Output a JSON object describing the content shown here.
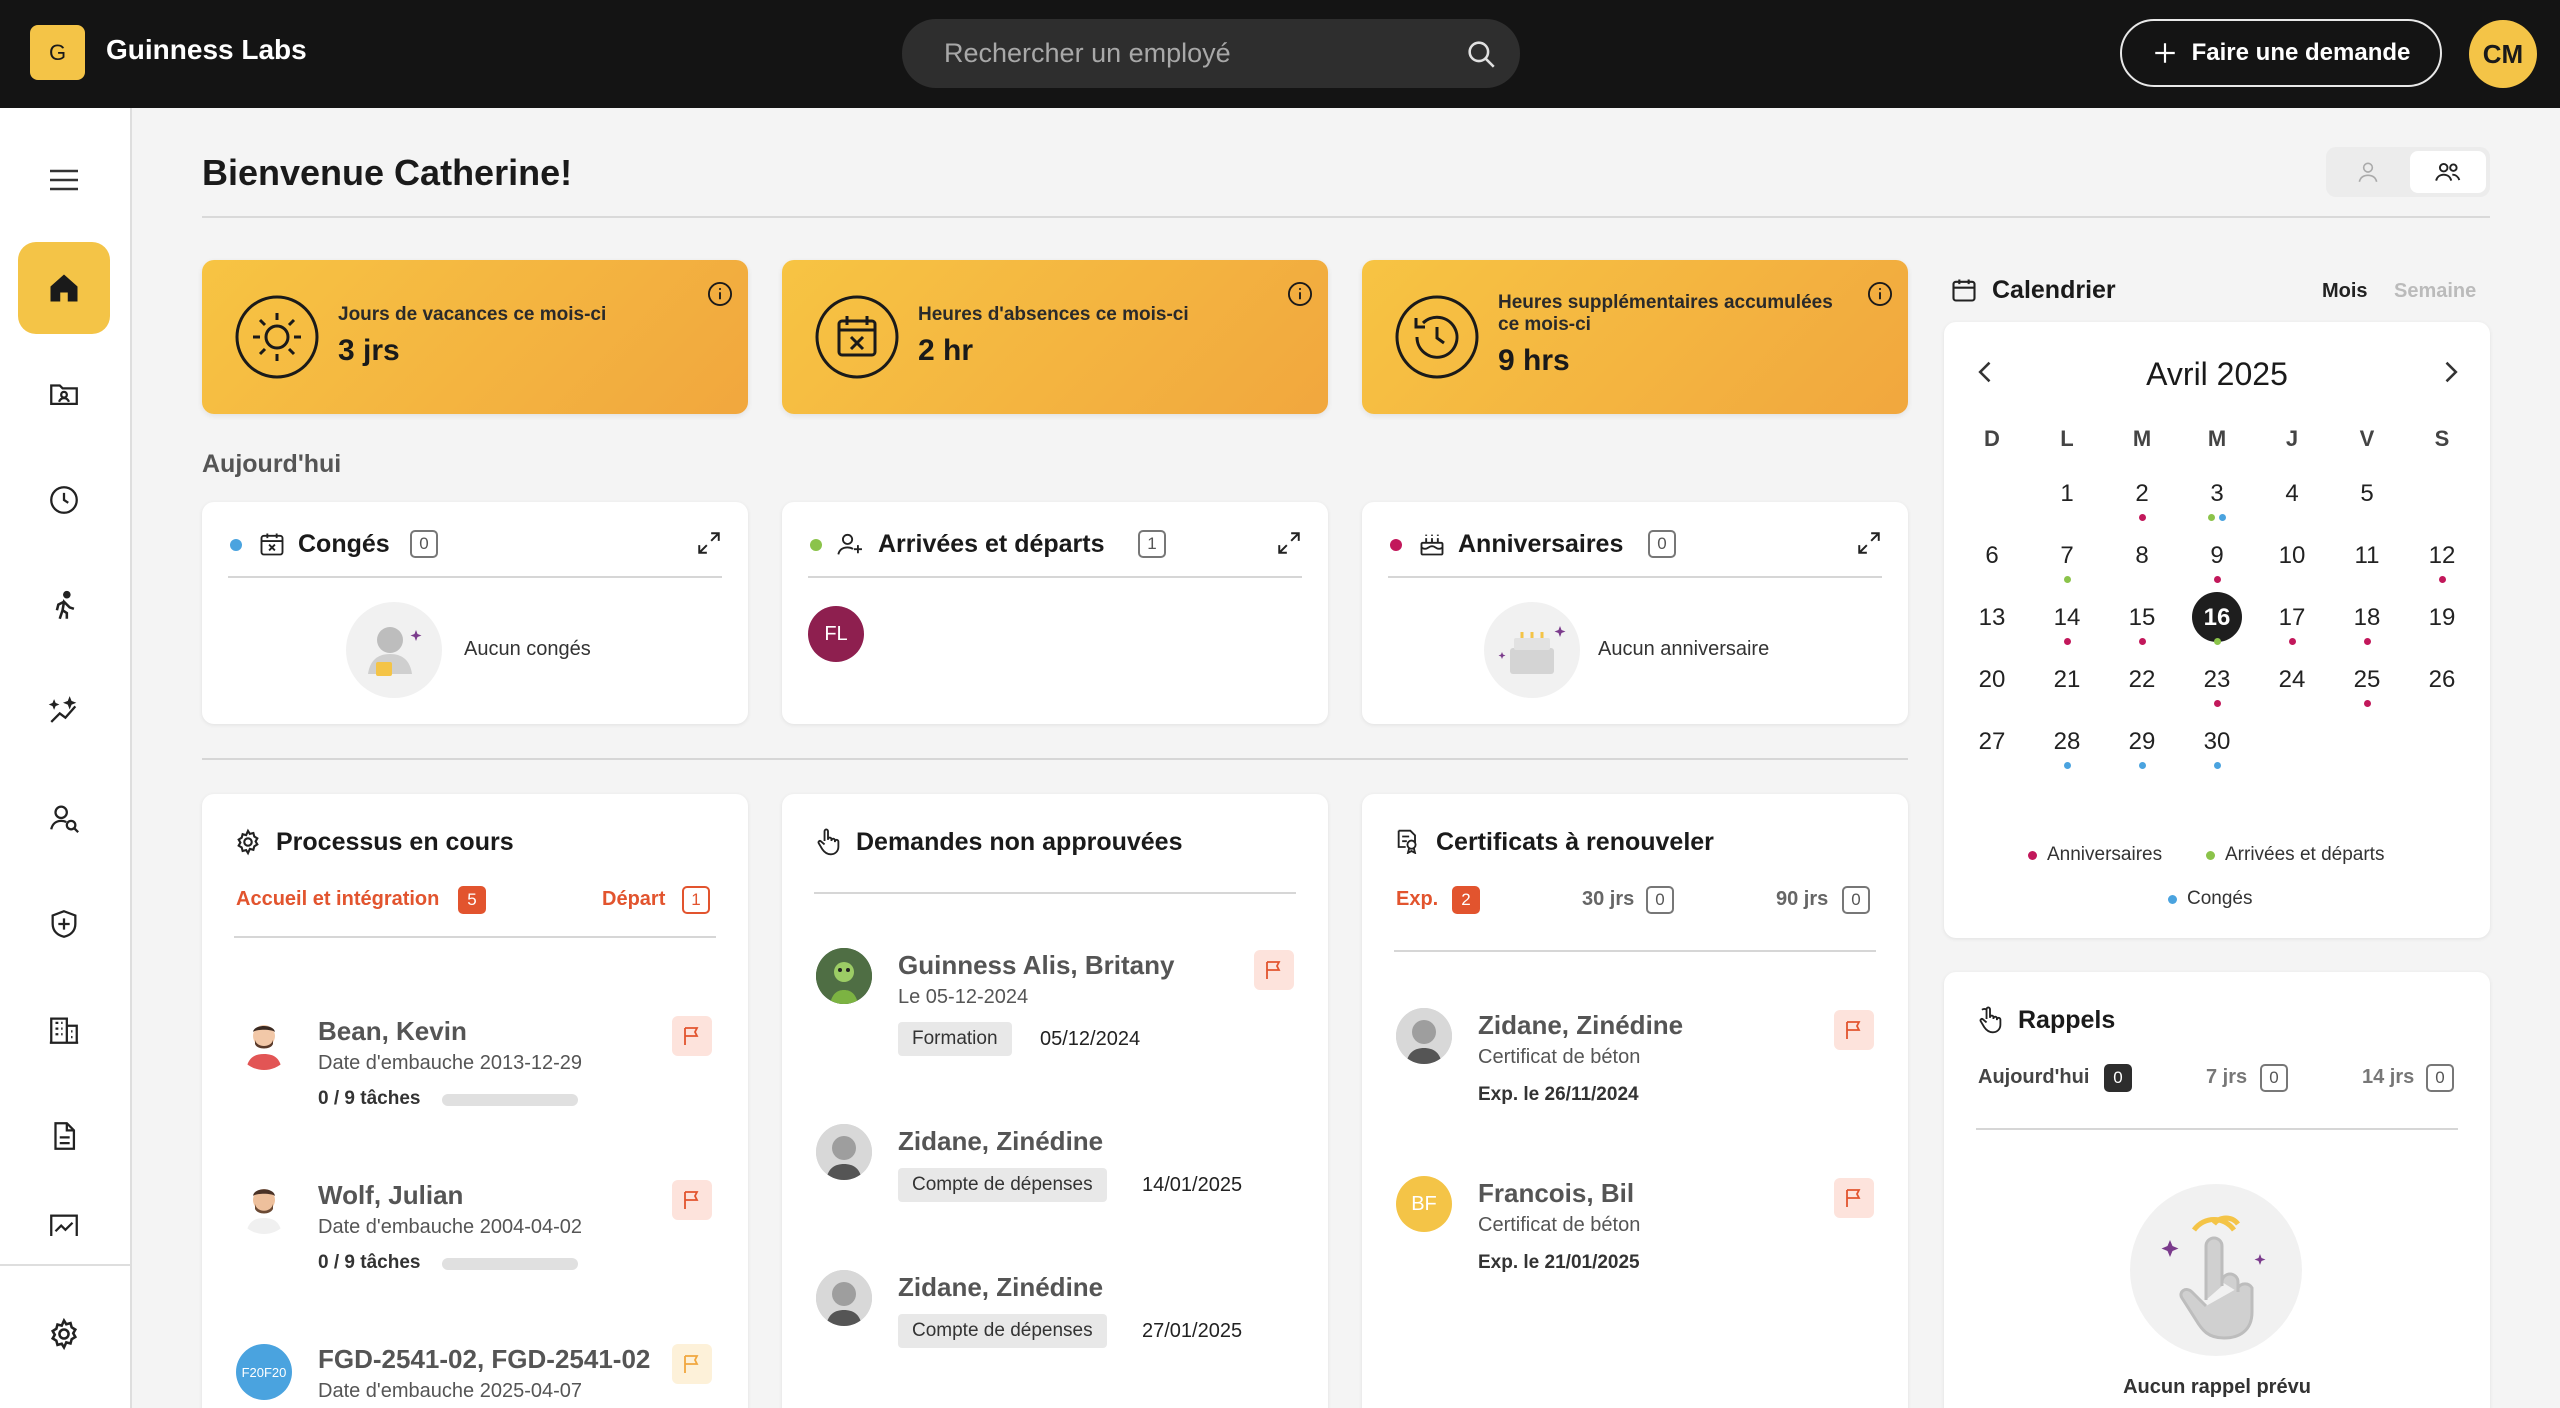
{
  "topbar": {
    "logo_letter": "G",
    "app_name": "Guinness Labs",
    "search_placeholder": "Rechercher un employé",
    "request_button": "Faire une demande",
    "user_initials": "CM"
  },
  "header": {
    "title": "Bienvenue Catherine!"
  },
  "kpis": [
    {
      "label": "Jours de vacances ce mois-ci",
      "value": "3 jrs"
    },
    {
      "label": "Heures d'absences ce mois-ci",
      "value": "2 hr"
    },
    {
      "label": "Heures supplémentaires accumulées ce mois-ci",
      "value": "9 hrs"
    }
  ],
  "today": {
    "label": "Aujourd'hui",
    "conges": {
      "title": "Congés",
      "count": "0",
      "empty": "Aucun congés"
    },
    "arrivees": {
      "title": "Arrivées et départs",
      "count": "1",
      "avatar_initials": "FL"
    },
    "anniversaires": {
      "title": "Anniversaires",
      "count": "0",
      "empty": "Aucun anniversaire"
    }
  },
  "processus": {
    "title": "Processus en cours",
    "tab_accueil": "Accueil et intégration",
    "tab_accueil_count": "5",
    "tab_depart": "Départ",
    "tab_depart_count": "1",
    "items": [
      {
        "name": "Bean, Kevin",
        "date": "Date d'embauche 2013-12-29",
        "tasks": "0 / 9 tâches"
      },
      {
        "name": "Wolf, Julian",
        "date": "Date d'embauche 2004-04-02",
        "tasks": "0 / 9 tâches"
      },
      {
        "name": "FGD-2541-02, FGD-2541-02",
        "date": "Date d'embauche 2025-04-07",
        "avatar_text": "F20F20"
      }
    ]
  },
  "demandes": {
    "title": "Demandes non approuvées",
    "items": [
      {
        "name": "Guinness Alis, Britany",
        "sub": "Le 05-12-2024",
        "tag": "Formation",
        "date": "05/12/2024"
      },
      {
        "name": "Zidane, Zinédine",
        "tag": "Compte de dépenses",
        "date": "14/01/2025"
      },
      {
        "name": "Zidane, Zinédine",
        "tag": "Compte de dépenses",
        "date": "27/01/2025"
      }
    ]
  },
  "certificats": {
    "title": "Certificats à renouveler",
    "tab_exp": "Exp.",
    "tab_exp_count": "2",
    "tab_30": "30 jrs",
    "tab_30_count": "0",
    "tab_90": "90 jrs",
    "tab_90_count": "0",
    "items": [
      {
        "name": "Zidane, Zinédine",
        "sub": "Certificat de béton",
        "exp": "Exp. le 26/11/2024"
      },
      {
        "name": "Francois, Bil",
        "sub": "Certificat de béton",
        "exp": "Exp. le 21/01/2025",
        "initials": "BF"
      }
    ]
  },
  "calendar": {
    "title": "Calendrier",
    "view_month": "Mois",
    "view_week": "Semaine",
    "month_label": "Avril 2025",
    "weekdays": [
      "D",
      "L",
      "M",
      "M",
      "J",
      "V",
      "S"
    ],
    "today": "16",
    "legend_anniv": "Anniversaires",
    "legend_arrivees": "Arrivées et départs",
    "legend_conges": "Congés",
    "colors": {
      "anniv": "#c2185b",
      "arrivees": "#8bc34a",
      "conges": "#4aa3df"
    },
    "days": [
      {
        "d": "1",
        "col": 1,
        "row": 0,
        "dots": []
      },
      {
        "d": "2",
        "col": 2,
        "row": 0,
        "dots": [
          "anniv"
        ]
      },
      {
        "d": "3",
        "col": 3,
        "row": 0,
        "dots": [
          "arrivees",
          "conges"
        ]
      },
      {
        "d": "4",
        "col": 4,
        "row": 0,
        "dots": []
      },
      {
        "d": "5",
        "col": 5,
        "row": 0,
        "dots": []
      },
      {
        "d": "6",
        "col": 0,
        "row": 1,
        "dots": []
      },
      {
        "d": "7",
        "col": 1,
        "row": 1,
        "dots": [
          "arrivees"
        ]
      },
      {
        "d": "8",
        "col": 2,
        "row": 1,
        "dots": []
      },
      {
        "d": "9",
        "col": 3,
        "row": 1,
        "dots": [
          "anniv"
        ]
      },
      {
        "d": "10",
        "col": 4,
        "row": 1,
        "dots": []
      },
      {
        "d": "11",
        "col": 5,
        "row": 1,
        "dots": []
      },
      {
        "d": "12",
        "col": 6,
        "row": 1,
        "dots": [
          "anniv"
        ]
      },
      {
        "d": "13",
        "col": 0,
        "row": 2,
        "dots": []
      },
      {
        "d": "14",
        "col": 1,
        "row": 2,
        "dots": [
          "anniv"
        ]
      },
      {
        "d": "15",
        "col": 2,
        "row": 2,
        "dots": [
          "anniv"
        ]
      },
      {
        "d": "16",
        "col": 3,
        "row": 2,
        "dots": [
          "arrivees"
        ]
      },
      {
        "d": "17",
        "col": 4,
        "row": 2,
        "dots": [
          "anniv"
        ]
      },
      {
        "d": "18",
        "col": 5,
        "row": 2,
        "dots": [
          "anniv"
        ]
      },
      {
        "d": "19",
        "col": 6,
        "row": 2,
        "dots": []
      },
      {
        "d": "20",
        "col": 0,
        "row": 3,
        "dots": []
      },
      {
        "d": "21",
        "col": 1,
        "row": 3,
        "dots": []
      },
      {
        "d": "22",
        "col": 2,
        "row": 3,
        "dots": []
      },
      {
        "d": "23",
        "col": 3,
        "row": 3,
        "dots": [
          "anniv"
        ]
      },
      {
        "d": "24",
        "col": 4,
        "row": 3,
        "dots": []
      },
      {
        "d": "25",
        "col": 5,
        "row": 3,
        "dots": [
          "anniv"
        ]
      },
      {
        "d": "26",
        "col": 6,
        "row": 3,
        "dots": []
      },
      {
        "d": "27",
        "col": 0,
        "row": 4,
        "dots": []
      },
      {
        "d": "28",
        "col": 1,
        "row": 4,
        "dots": [
          "conges"
        ]
      },
      {
        "d": "29",
        "col": 2,
        "row": 4,
        "dots": [
          "conges"
        ]
      },
      {
        "d": "30",
        "col": 3,
        "row": 4,
        "dots": [
          "conges"
        ]
      }
    ]
  },
  "rappels": {
    "title": "Rappels",
    "tab_today": "Aujourd'hui",
    "tab_today_count": "0",
    "tab_7": "7 jrs",
    "tab_7_count": "0",
    "tab_14": "14 jrs",
    "tab_14_count": "0",
    "empty": "Aucun rappel prévu"
  },
  "sidebar": {
    "icons": [
      "home-icon",
      "contact-folder-icon",
      "clock-icon",
      "activity-icon",
      "sparkle-chart-icon",
      "search-user-icon",
      "shield-icon",
      "building-icon",
      "document-icon",
      "chart-icon",
      "settings-icon"
    ]
  }
}
